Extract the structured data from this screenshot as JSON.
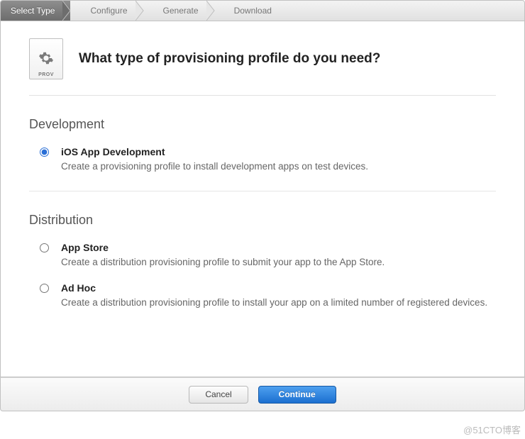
{
  "steps": {
    "items": [
      {
        "label": "Select Type",
        "active": true
      },
      {
        "label": "Configure",
        "active": false
      },
      {
        "label": "Generate",
        "active": false
      },
      {
        "label": "Download",
        "active": false
      }
    ]
  },
  "icon": {
    "badge": "PROV"
  },
  "heading": "What type of provisioning profile do you need?",
  "sections": {
    "development": {
      "title": "Development",
      "options": [
        {
          "id": "ios-app-dev",
          "label": "iOS App Development",
          "desc": "Create a provisioning profile to install development apps on test devices.",
          "selected": true
        }
      ]
    },
    "distribution": {
      "title": "Distribution",
      "options": [
        {
          "id": "app-store",
          "label": "App Store",
          "desc": "Create a distribution provisioning profile to submit your app to the App Store.",
          "selected": false
        },
        {
          "id": "ad-hoc",
          "label": "Ad Hoc",
          "desc": "Create a distribution provisioning profile to install your app on a limited number of registered devices.",
          "selected": false
        }
      ]
    }
  },
  "footer": {
    "cancel": "Cancel",
    "continue": "Continue"
  },
  "watermark": "@51CTO博客"
}
